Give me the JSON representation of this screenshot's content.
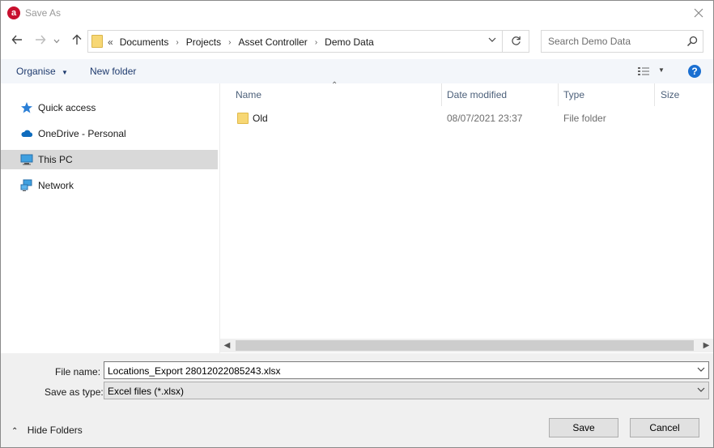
{
  "window": {
    "title": "Save As",
    "app_icon_letter": "a"
  },
  "nav": {
    "breadcrumb_lead": "«",
    "breadcrumbs": [
      "Documents",
      "Projects",
      "Asset Controller",
      "Demo Data"
    ],
    "search_placeholder": "Search Demo Data"
  },
  "toolbar": {
    "organise_label": "Organise",
    "new_folder_label": "New folder",
    "help_glyph": "?"
  },
  "sidebar": {
    "items": [
      {
        "label": "Quick access",
        "icon": "star-icon"
      },
      {
        "label": "OneDrive - Personal",
        "icon": "cloud-icon"
      },
      {
        "label": "This PC",
        "icon": "computer-icon",
        "selected": true
      },
      {
        "label": "Network",
        "icon": "network-icon"
      }
    ]
  },
  "file_list": {
    "columns": [
      "Name",
      "Date modified",
      "Type",
      "Size"
    ],
    "rows": [
      {
        "name": "Old",
        "date_modified": "08/07/2021 23:37",
        "type": "File folder",
        "size": ""
      }
    ]
  },
  "form": {
    "file_name_label": "File name:",
    "file_name_value": "Locations_Export 28012022085243.xlsx",
    "save_type_label": "Save as type:",
    "save_type_value": "Excel files (*.xlsx)"
  },
  "footer": {
    "hide_folders_label": "Hide Folders",
    "save_label": "Save",
    "cancel_label": "Cancel"
  },
  "colors": {
    "accent": "#1a6fd1",
    "app_icon": "#c8102e",
    "folder": "#f7d774",
    "selected_nav": "#d9d9d9"
  }
}
